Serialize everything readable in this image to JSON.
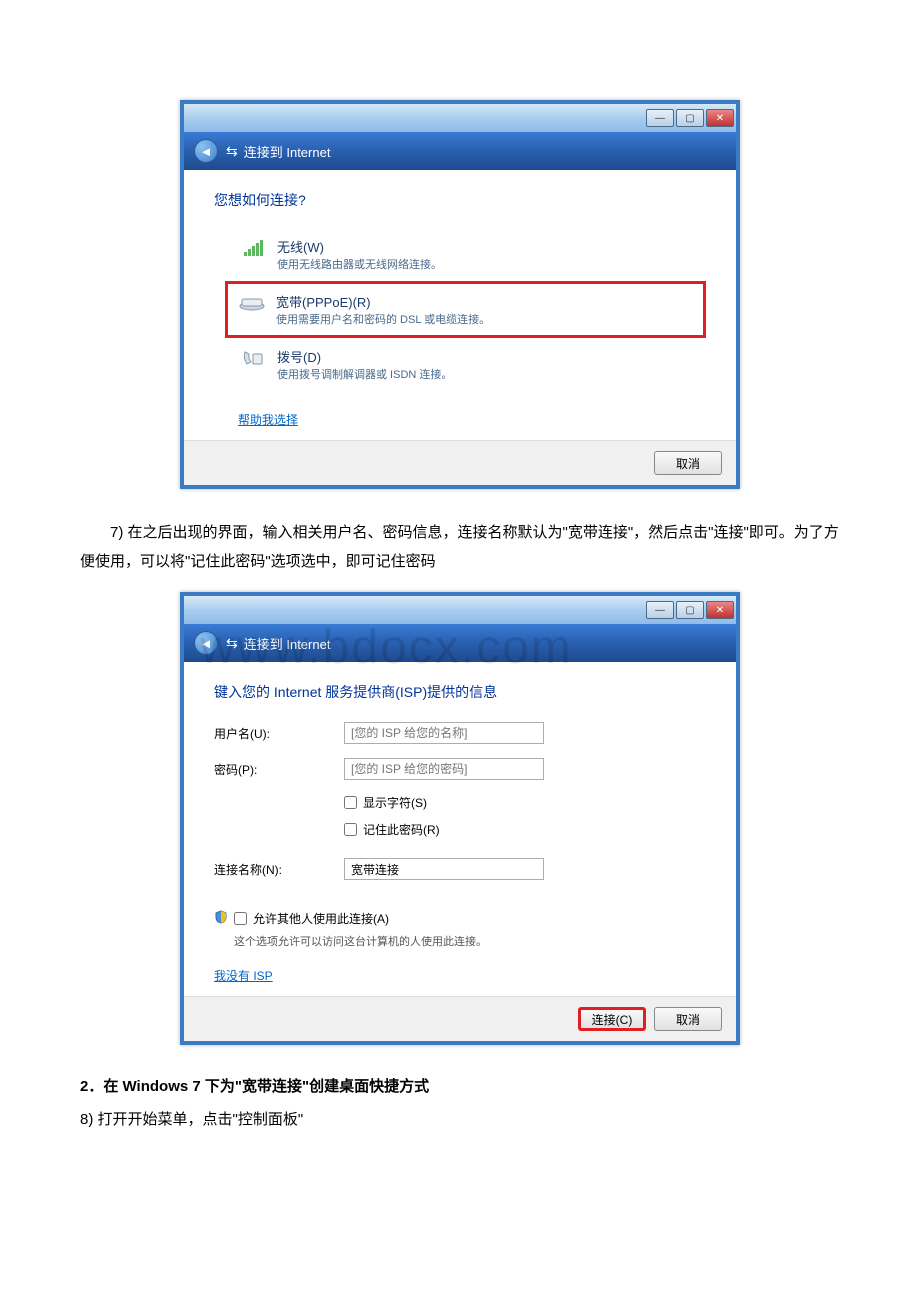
{
  "dialog1": {
    "titlebar_icons": {
      "min": "—",
      "max": "▢",
      "close": "✕"
    },
    "header": {
      "back": "◄",
      "icon": "⇆",
      "title": "连接到 Internet"
    },
    "question": "您想如何连接?",
    "options": {
      "wireless": {
        "title": "无线(W)",
        "desc": "使用无线路由器或无线网络连接。"
      },
      "pppoe": {
        "title": "宽带(PPPoE)(R)",
        "desc": "使用需要用户名和密码的 DSL 或电缆连接。"
      },
      "dialup": {
        "title": "拨号(D)",
        "desc": "使用拨号调制解调器或 ISDN 连接。"
      }
    },
    "help_link": "帮助我选择",
    "cancel": "取消"
  },
  "para7": "7) 在之后出现的界面，输入相关用户名、密码信息，连接名称默认为\"宽带连接\"，然后点击\"连接\"即可。为了方便使用，可以将\"记住此密码\"选项选中，即可记住密码",
  "dialog2": {
    "header": {
      "back": "◄",
      "icon": "⇆",
      "title": "连接到 Internet"
    },
    "heading": "键入您的 Internet 服务提供商(ISP)提供的信息",
    "username_label": "用户名(U):",
    "username_placeholder": "[您的 ISP 给您的名称]",
    "password_label": "密码(P):",
    "password_placeholder": "[您的 ISP 给您的密码]",
    "show_chars": "显示字符(S)",
    "remember": "记住此密码(R)",
    "connname_label": "连接名称(N):",
    "connname_value": "宽带连接",
    "allow_label": "允许其他人使用此连接(A)",
    "allow_desc": "这个选项允许可以访问这台计算机的人使用此连接。",
    "no_isp": "我没有 ISP",
    "connect": "连接(C)",
    "cancel": "取消"
  },
  "section2": "2．在 Windows 7 下为\"宽带连接\"创建桌面快捷方式",
  "step8": "8) 打开开始菜单，点击\"控制面板\"",
  "watermark": "www.bdocx.com"
}
